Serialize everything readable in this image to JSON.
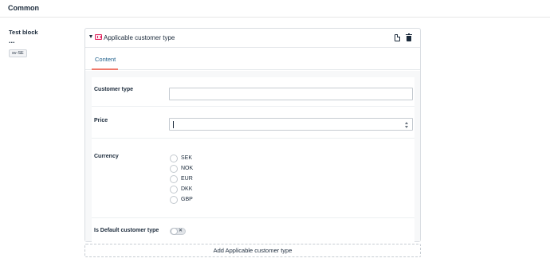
{
  "header": {
    "title": "Common"
  },
  "block": {
    "name": "Test block",
    "more_label": "...",
    "language": "sv-SE"
  },
  "card": {
    "title": "Applicable customer type",
    "tabs": [
      {
        "label": "Content"
      }
    ]
  },
  "form": {
    "customer_type": {
      "label": "Customer type",
      "value": ""
    },
    "price": {
      "label": "Price",
      "value": ""
    },
    "currency": {
      "label": "Currency",
      "options": [
        "SEK",
        "NOK",
        "EUR",
        "DKK",
        "GBP"
      ]
    },
    "is_default": {
      "label": "Is Default customer type",
      "toggle_symbol": "✕"
    }
  },
  "add_button": {
    "label": "Add Applicable customer type"
  },
  "colors": {
    "accent_tab": "#1f5f8b",
    "tab_underline": "#f0796b",
    "type_icon": "#e0245e"
  },
  "icons": {
    "caret": "chevron-down-icon",
    "type": "block-type-icon",
    "copy": "copy-icon",
    "delete": "trash-icon"
  }
}
